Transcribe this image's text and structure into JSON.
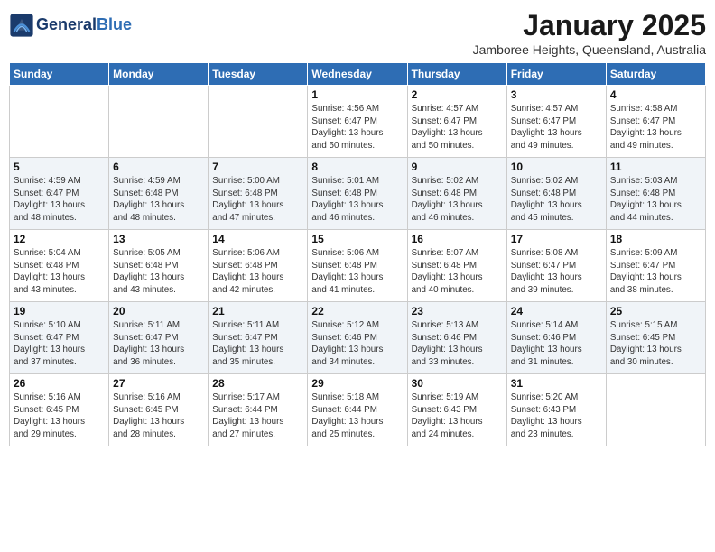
{
  "header": {
    "logo_line1": "General",
    "logo_line2": "Blue",
    "title": "January 2025",
    "subtitle": "Jamboree Heights, Queensland, Australia"
  },
  "weekdays": [
    "Sunday",
    "Monday",
    "Tuesday",
    "Wednesday",
    "Thursday",
    "Friday",
    "Saturday"
  ],
  "weeks": [
    [
      {
        "num": "",
        "detail": ""
      },
      {
        "num": "",
        "detail": ""
      },
      {
        "num": "",
        "detail": ""
      },
      {
        "num": "1",
        "detail": "Sunrise: 4:56 AM\nSunset: 6:47 PM\nDaylight: 13 hours\nand 50 minutes."
      },
      {
        "num": "2",
        "detail": "Sunrise: 4:57 AM\nSunset: 6:47 PM\nDaylight: 13 hours\nand 50 minutes."
      },
      {
        "num": "3",
        "detail": "Sunrise: 4:57 AM\nSunset: 6:47 PM\nDaylight: 13 hours\nand 49 minutes."
      },
      {
        "num": "4",
        "detail": "Sunrise: 4:58 AM\nSunset: 6:47 PM\nDaylight: 13 hours\nand 49 minutes."
      }
    ],
    [
      {
        "num": "5",
        "detail": "Sunrise: 4:59 AM\nSunset: 6:47 PM\nDaylight: 13 hours\nand 48 minutes."
      },
      {
        "num": "6",
        "detail": "Sunrise: 4:59 AM\nSunset: 6:48 PM\nDaylight: 13 hours\nand 48 minutes."
      },
      {
        "num": "7",
        "detail": "Sunrise: 5:00 AM\nSunset: 6:48 PM\nDaylight: 13 hours\nand 47 minutes."
      },
      {
        "num": "8",
        "detail": "Sunrise: 5:01 AM\nSunset: 6:48 PM\nDaylight: 13 hours\nand 46 minutes."
      },
      {
        "num": "9",
        "detail": "Sunrise: 5:02 AM\nSunset: 6:48 PM\nDaylight: 13 hours\nand 46 minutes."
      },
      {
        "num": "10",
        "detail": "Sunrise: 5:02 AM\nSunset: 6:48 PM\nDaylight: 13 hours\nand 45 minutes."
      },
      {
        "num": "11",
        "detail": "Sunrise: 5:03 AM\nSunset: 6:48 PM\nDaylight: 13 hours\nand 44 minutes."
      }
    ],
    [
      {
        "num": "12",
        "detail": "Sunrise: 5:04 AM\nSunset: 6:48 PM\nDaylight: 13 hours\nand 43 minutes."
      },
      {
        "num": "13",
        "detail": "Sunrise: 5:05 AM\nSunset: 6:48 PM\nDaylight: 13 hours\nand 43 minutes."
      },
      {
        "num": "14",
        "detail": "Sunrise: 5:06 AM\nSunset: 6:48 PM\nDaylight: 13 hours\nand 42 minutes."
      },
      {
        "num": "15",
        "detail": "Sunrise: 5:06 AM\nSunset: 6:48 PM\nDaylight: 13 hours\nand 41 minutes."
      },
      {
        "num": "16",
        "detail": "Sunrise: 5:07 AM\nSunset: 6:48 PM\nDaylight: 13 hours\nand 40 minutes."
      },
      {
        "num": "17",
        "detail": "Sunrise: 5:08 AM\nSunset: 6:47 PM\nDaylight: 13 hours\nand 39 minutes."
      },
      {
        "num": "18",
        "detail": "Sunrise: 5:09 AM\nSunset: 6:47 PM\nDaylight: 13 hours\nand 38 minutes."
      }
    ],
    [
      {
        "num": "19",
        "detail": "Sunrise: 5:10 AM\nSunset: 6:47 PM\nDaylight: 13 hours\nand 37 minutes."
      },
      {
        "num": "20",
        "detail": "Sunrise: 5:11 AM\nSunset: 6:47 PM\nDaylight: 13 hours\nand 36 minutes."
      },
      {
        "num": "21",
        "detail": "Sunrise: 5:11 AM\nSunset: 6:47 PM\nDaylight: 13 hours\nand 35 minutes."
      },
      {
        "num": "22",
        "detail": "Sunrise: 5:12 AM\nSunset: 6:46 PM\nDaylight: 13 hours\nand 34 minutes."
      },
      {
        "num": "23",
        "detail": "Sunrise: 5:13 AM\nSunset: 6:46 PM\nDaylight: 13 hours\nand 33 minutes."
      },
      {
        "num": "24",
        "detail": "Sunrise: 5:14 AM\nSunset: 6:46 PM\nDaylight: 13 hours\nand 31 minutes."
      },
      {
        "num": "25",
        "detail": "Sunrise: 5:15 AM\nSunset: 6:45 PM\nDaylight: 13 hours\nand 30 minutes."
      }
    ],
    [
      {
        "num": "26",
        "detail": "Sunrise: 5:16 AM\nSunset: 6:45 PM\nDaylight: 13 hours\nand 29 minutes."
      },
      {
        "num": "27",
        "detail": "Sunrise: 5:16 AM\nSunset: 6:45 PM\nDaylight: 13 hours\nand 28 minutes."
      },
      {
        "num": "28",
        "detail": "Sunrise: 5:17 AM\nSunset: 6:44 PM\nDaylight: 13 hours\nand 27 minutes."
      },
      {
        "num": "29",
        "detail": "Sunrise: 5:18 AM\nSunset: 6:44 PM\nDaylight: 13 hours\nand 25 minutes."
      },
      {
        "num": "30",
        "detail": "Sunrise: 5:19 AM\nSunset: 6:43 PM\nDaylight: 13 hours\nand 24 minutes."
      },
      {
        "num": "31",
        "detail": "Sunrise: 5:20 AM\nSunset: 6:43 PM\nDaylight: 13 hours\nand 23 minutes."
      },
      {
        "num": "",
        "detail": ""
      }
    ]
  ]
}
